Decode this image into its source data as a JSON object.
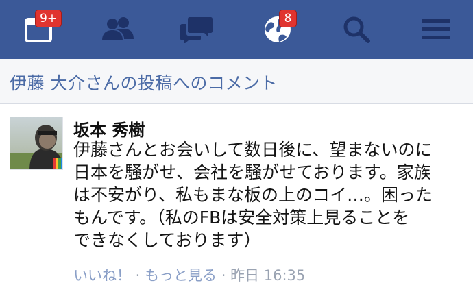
{
  "nav": {
    "notifications_badge": "9+",
    "globe_badge": "8",
    "icons": [
      "calendar-icon",
      "friends-icon",
      "messages-icon",
      "globe-icon",
      "search-icon",
      "menu-icon"
    ]
  },
  "post_header": {
    "title": "伊藤 大介さんの投稿へのコメント"
  },
  "comment": {
    "author": "坂本 秀樹",
    "lines": [
      "伊藤さんとお会いして数日後に、望まないのに",
      "日本を騒がせ、会社を騒がせております。家族",
      "は不安がり、私もまな板の上のコイ…。困った",
      "もんです。（私のFBは安全対策上見ることを",
      "できなくしております）"
    ],
    "like_label": "いいね！",
    "separator": " · ",
    "more_label": "もっと見る",
    "timestamp": "昨日 16:35"
  },
  "colors": {
    "nav_bg": "#3b5998",
    "badge": "#e0342f",
    "header_text": "#4b6ba6"
  }
}
